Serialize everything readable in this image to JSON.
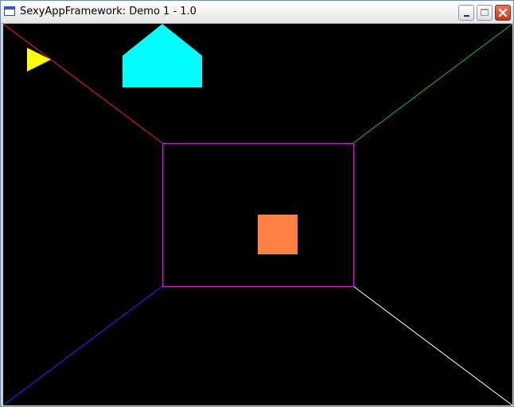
{
  "window": {
    "title": "SexyAppFramework: Demo 1 - 1.0",
    "icon": "application-window-icon",
    "buttons": [
      "minimize-icon",
      "maximize-icon",
      "close-icon"
    ]
  },
  "scene": {
    "background_color": "#000000",
    "room_outline_color": "#d020d0",
    "corner_line_colors": {
      "top_left": "#ff2020",
      "top_right": "#20c020",
      "bottom_left": "#2030ff",
      "bottom_right": "#ffffff"
    },
    "objects": [
      {
        "name": "yellow-triangle",
        "color": "#ffff00"
      },
      {
        "name": "cyan-house-shape",
        "color": "#00ffff"
      },
      {
        "name": "orange-square",
        "color": "#ff8040"
      }
    ]
  }
}
